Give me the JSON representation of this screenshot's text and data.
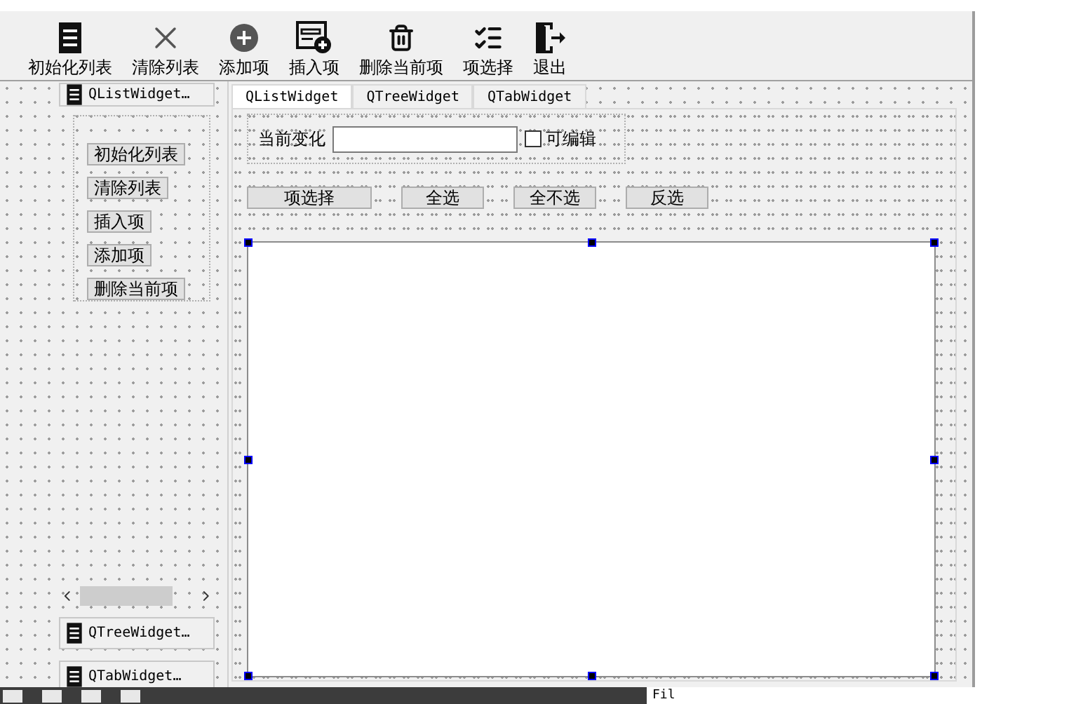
{
  "toolbar": [
    {
      "kind": "list",
      "label": "初始化列表"
    },
    {
      "kind": "clear",
      "label": "清除列表"
    },
    {
      "kind": "add",
      "label": "添加项"
    },
    {
      "kind": "insert",
      "label": "插入项"
    },
    {
      "kind": "delete",
      "label": "删除当前项"
    },
    {
      "kind": "select",
      "label": "项选择"
    },
    {
      "kind": "exit",
      "label": "退出"
    }
  ],
  "toolbox_top": {
    "label": "QListWidget…"
  },
  "left_buttons": [
    "初始化列表",
    "清除列表",
    "插入项",
    "添加项",
    "删除当前项"
  ],
  "toolbox_bottom": [
    {
      "label": "QTreeWidget…"
    },
    {
      "label": "QTabWidget…"
    }
  ],
  "tabs": [
    {
      "label": "QListWidget",
      "selected": true
    },
    {
      "label": "QTreeWidget",
      "selected": false
    },
    {
      "label": "QTabWidget",
      "selected": false
    }
  ],
  "current_change": {
    "label": "当前变化"
  },
  "editable": {
    "label": "可编辑",
    "checked": false
  },
  "select_buttons": [
    "项选择",
    "全选",
    "全不选",
    "反选"
  ],
  "taskbar": {
    "text": "Fil"
  }
}
